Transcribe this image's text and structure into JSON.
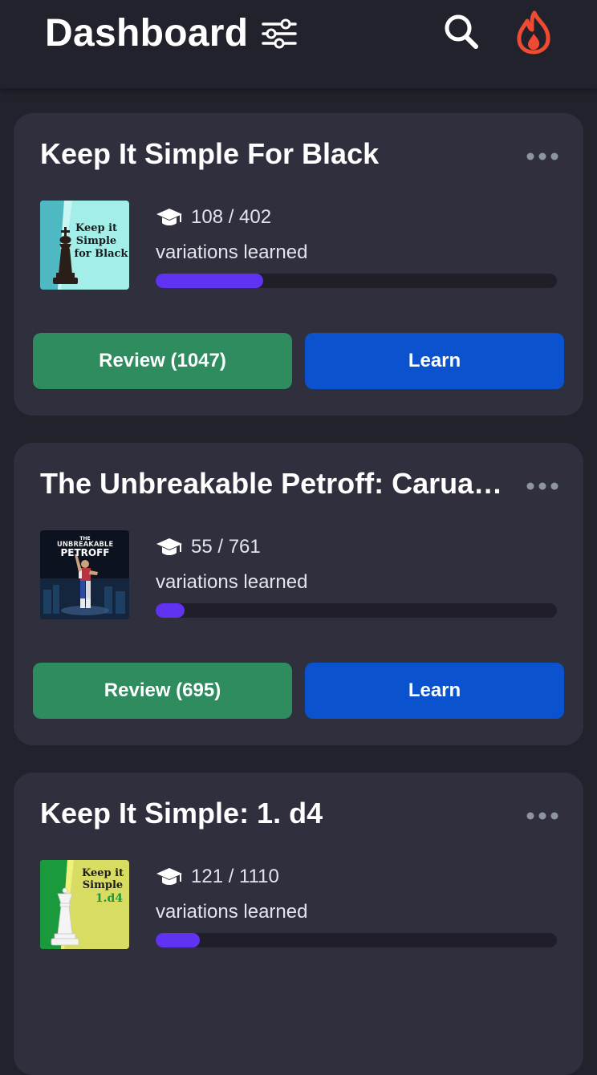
{
  "header": {
    "title": "Dashboard",
    "icons": [
      "sliders-icon",
      "search-icon",
      "flame-icon"
    ],
    "flame_color": "#f04a33"
  },
  "colors": {
    "background": "#22222d",
    "card": "#302f3e",
    "review_button": "#2e8c5e",
    "learn_button": "#0b52cf",
    "progress_fill": "#6033f2"
  },
  "courses": [
    {
      "title": "Keep It Simple For Black",
      "cover_text": [
        "Keep it",
        "Simple",
        "for Black"
      ],
      "learned_count": "108 / 402",
      "variations_label": "variations learned",
      "progress": 0.2687,
      "review_label": "Review (1047)",
      "learn_label": "Learn"
    },
    {
      "title": "The Unbreakable Petroff: Caruan…",
      "cover_text": [
        "THE",
        "UNBREAKABLE",
        "PETROFF"
      ],
      "learned_count": "55 / 761",
      "variations_label": "variations learned",
      "progress": 0.0723,
      "review_label": "Review (695)",
      "learn_label": "Learn"
    },
    {
      "title": "Keep It Simple: 1. d4",
      "cover_text": [
        "Keep it",
        "Simple",
        "1.d4"
      ],
      "learned_count": "121 / 1110",
      "variations_label": "variations learned",
      "progress": 0.109
    }
  ]
}
